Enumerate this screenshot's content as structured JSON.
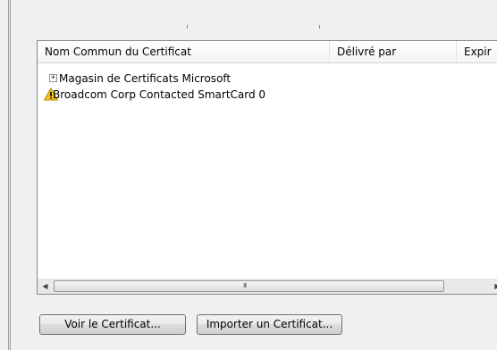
{
  "columns": [
    {
      "label": "Nom Commun du Certificat"
    },
    {
      "label": "Délivré par"
    },
    {
      "label": "Expir"
    }
  ],
  "rows": [
    {
      "label": "Magasin de Certificats Microsoft",
      "expander": "+",
      "icon": "expand-icon"
    },
    {
      "label": "Broadcom Corp Contacted SmartCard 0",
      "icon": "warning-icon"
    }
  ],
  "scrollbar": {
    "grip": "III",
    "left_arrow": "◀",
    "right_arrow": "▶"
  },
  "buttons": {
    "view_certificate": "Voir le Certificat...",
    "import_certificate": "Importer un Certificat..."
  },
  "colors": {
    "warning_fill": "#f5c518",
    "warning_outline": "#b58a00"
  }
}
